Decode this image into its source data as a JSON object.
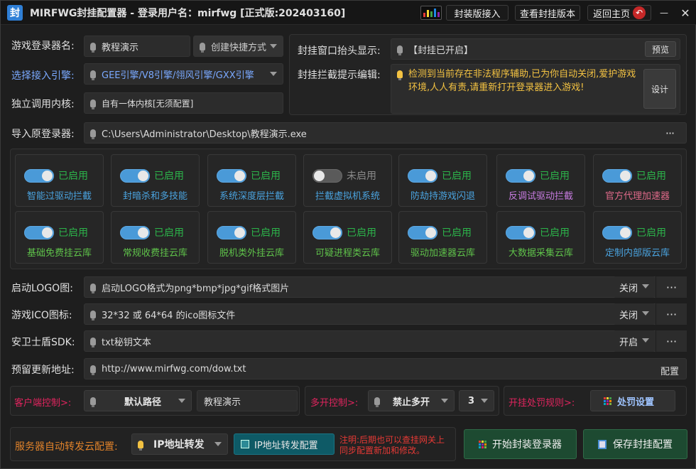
{
  "window": {
    "logo_char": "封",
    "title": "MIRFWG封挂配置器 - 登录用户名：mirfwg  [正式版:202403160]",
    "btn_pack": "封装版接入",
    "btn_view": "查看封挂版本",
    "btn_home": "返回主页",
    "minimize": "—",
    "close": "✕"
  },
  "form": {
    "launcher_label": "游戏登录器名:",
    "launcher_value": "教程演示",
    "shortcut_value": "创建快捷方式",
    "engine_label": "选择接入引擎:",
    "engine_value": "GEE引擎/V8引擎/翎风引擎/GXX引擎",
    "kernel_label": "独立调用内核:",
    "kernel_value": "自有一体内核[无须配置]",
    "import_label": "导入原登录器:",
    "import_value": "C:\\Users\\Administrator\\Desktop\\教程演示.exe",
    "window_title_label": "封挂窗口抬头显示:",
    "window_title_value": "【封挂已开启】",
    "preview_button": "预览",
    "block_tip_label": "封挂拦截提示编辑:",
    "block_tip_value": "检测到当前存在非法程序辅助,已为你自动关闭,爱护游戏环境,人人有责,请重新打开登录器进入游戏!",
    "design_button": "设计"
  },
  "features": [
    {
      "state": "已启用",
      "enabled": true,
      "name": "智能过驱动拦截",
      "color": "#4aa3df"
    },
    {
      "state": "已启用",
      "enabled": true,
      "name": "封暗杀和多技能",
      "color": "#4aa3df"
    },
    {
      "state": "已启用",
      "enabled": true,
      "name": "系统深度层拦截",
      "color": "#4aa3df"
    },
    {
      "state": "未启用",
      "enabled": false,
      "name": "拦截虚拟机系统",
      "color": "#4aa3df"
    },
    {
      "state": "已启用",
      "enabled": true,
      "name": "防劫持游戏闪退",
      "color": "#4aa3df"
    },
    {
      "state": "已启用",
      "enabled": true,
      "name": "反调试驱动拦截",
      "color": "#c77be0"
    },
    {
      "state": "已启用",
      "enabled": true,
      "name": "官方代理加速器",
      "color": "#e06a8a"
    },
    {
      "state": "已启用",
      "enabled": true,
      "name": "基础免费挂云库",
      "color": "#5fc24a"
    },
    {
      "state": "已启用",
      "enabled": true,
      "name": "常规收费挂云库",
      "color": "#5fc24a"
    },
    {
      "state": "已启用",
      "enabled": true,
      "name": "脱机类外挂云库",
      "color": "#5fc24a"
    },
    {
      "state": "已启用",
      "enabled": true,
      "name": "可疑进程类云库",
      "color": "#5fc24a"
    },
    {
      "state": "已启用",
      "enabled": true,
      "name": "驱动加速器云库",
      "color": "#5fc24a"
    },
    {
      "state": "已启用",
      "enabled": true,
      "name": "大数据采集云库",
      "color": "#5fc24a"
    },
    {
      "state": "已启用",
      "enabled": true,
      "name": "定制内部版云库",
      "color": "#4aa3df"
    }
  ],
  "settings": {
    "logo_label": "启动LOGO图:",
    "logo_value": "启动LOGO格式为png*bmp*jpg*gif格式图片",
    "logo_state": "关闭",
    "ico_label": "游戏ICO图标:",
    "ico_value": "32*32 或 64*64 的ico图标文件",
    "ico_state": "关闭",
    "sdk_label": "安卫士盾SDK:",
    "sdk_value": "txt秘钥文本",
    "sdk_state": "开启",
    "update_label": "预留更新地址:",
    "update_value": "http://www.mirfwg.com/dow.txt",
    "update_config": "配置"
  },
  "control": {
    "client_label": "客户端控制>:",
    "client_path": "默认路径",
    "client_name": "教程演示",
    "multi_label": "多开控制>:",
    "multi_value": "禁止多开",
    "multi_count": "3",
    "penalty_label": "开挂处罚规则>:",
    "penalty_button": "处罚设置"
  },
  "server": {
    "label": "服务器自动转发云配置:",
    "ip_value": "IP地址转发",
    "ip_config_button": "IP地址转发配置",
    "note": "注明:后期也可以查挂网关上同步配置新加和修改。",
    "start_button": "开始封装登录器",
    "save_button": "保存封挂配置"
  },
  "colors": {
    "accent_blue": "#4a9ad8",
    "enabled_green": "#2cb34a",
    "pink": "#e0245e",
    "orange": "#e0822a"
  }
}
